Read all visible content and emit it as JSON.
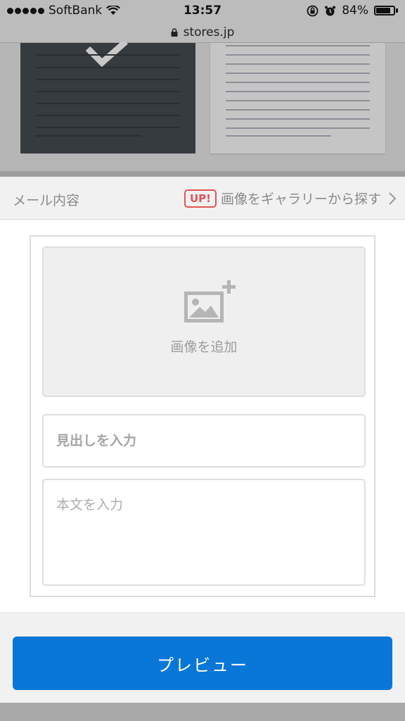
{
  "status_bar": {
    "carrier": "SoftBank",
    "time": "13:57",
    "battery": "84%",
    "battery_level": 0.84
  },
  "url_bar": {
    "domain": "stores.jp"
  },
  "section": {
    "title": "メール内容",
    "badge": "UP!",
    "gallery_link": "画像をギャラリーから探す"
  },
  "editor": {
    "add_image_label": "画像を追加",
    "heading_placeholder": "見出しを入力",
    "body_placeholder": "本文を入力"
  },
  "footer": {
    "preview_label": "プレビュー"
  },
  "colors": {
    "accent": "#0877d8",
    "badge": "#e25454",
    "template_dark": "#363b40"
  }
}
